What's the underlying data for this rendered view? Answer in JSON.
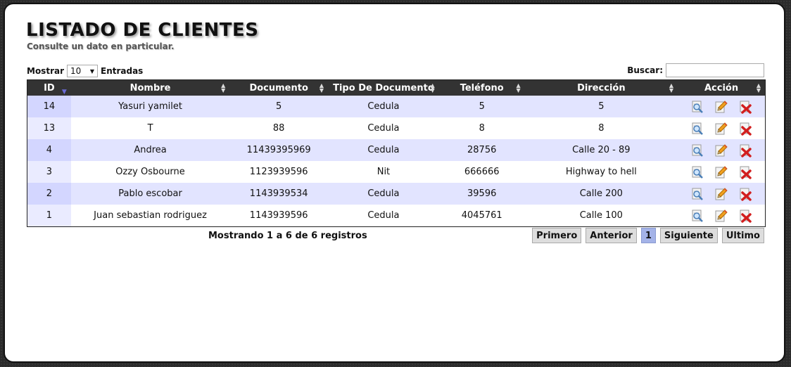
{
  "header": {
    "title": "LISTADO DE CLIENTES",
    "subtitle": "Consulte un dato en particular."
  },
  "controls": {
    "show_label": "Mostrar",
    "page_length": "10",
    "entries_label": "Entradas",
    "search_label": "Buscar:",
    "search_value": ""
  },
  "table": {
    "columns": [
      "ID",
      "Nombre",
      "Documento",
      "Tipo De Documento",
      "Teléfono",
      "Dirección",
      "Acción"
    ],
    "sorted_column": "ID",
    "sort_direction": "desc",
    "rows": [
      {
        "id": "14",
        "nombre": "Yasuri yamilet",
        "documento": "5",
        "tipo": "Cedula",
        "telefono": "5",
        "direccion": "5"
      },
      {
        "id": "13",
        "nombre": "T",
        "documento": "88",
        "tipo": "Cedula",
        "telefono": "8",
        "direccion": "8"
      },
      {
        "id": "4",
        "nombre": "Andrea",
        "documento": "11439395969",
        "tipo": "Cedula",
        "telefono": "28756",
        "direccion": "Calle 20 - 89"
      },
      {
        "id": "3",
        "nombre": "Ozzy Osbourne",
        "documento": "1123939596",
        "tipo": "Nit",
        "telefono": "666666",
        "direccion": "Highway to hell"
      },
      {
        "id": "2",
        "nombre": "Pablo escobar",
        "documento": "1143939534",
        "tipo": "Cedula",
        "telefono": "39596",
        "direccion": "Calle 200"
      },
      {
        "id": "1",
        "nombre": "Juan sebastian rodriguez",
        "documento": "1143939596",
        "tipo": "Cedula",
        "telefono": "4045761",
        "direccion": "Calle 100"
      }
    ],
    "row_actions": [
      "view-icon",
      "edit-icon",
      "delete-icon"
    ]
  },
  "footer": {
    "info": "Mostrando 1 a 6 de 6 registros",
    "paging": {
      "first": "Primero",
      "previous": "Anterior",
      "current_page": "1",
      "next": "Siguiente",
      "last": "Ultimo"
    }
  },
  "colors": {
    "header_bg": "#333333",
    "odd_row": "#e2e4ff",
    "current_page": "#a4b3e8"
  }
}
